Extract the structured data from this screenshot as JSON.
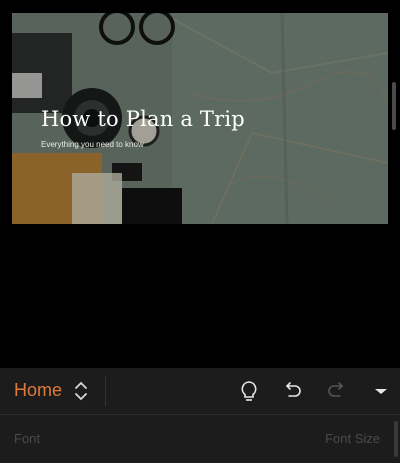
{
  "slide": {
    "title": "How to Plan a Trip",
    "subtitle": "Everything you need to know"
  },
  "toolbar": {
    "tab_label": "Home",
    "icons": {
      "switch": "chevron-up-down-icon",
      "ideas": "lightbulb-icon",
      "undo": "undo-icon",
      "redo": "redo-icon",
      "more": "caret-down-icon"
    },
    "accent_color": "#e07a3a"
  },
  "ribbon": {
    "font_placeholder": "Font",
    "font_size_placeholder": "Font Size"
  }
}
